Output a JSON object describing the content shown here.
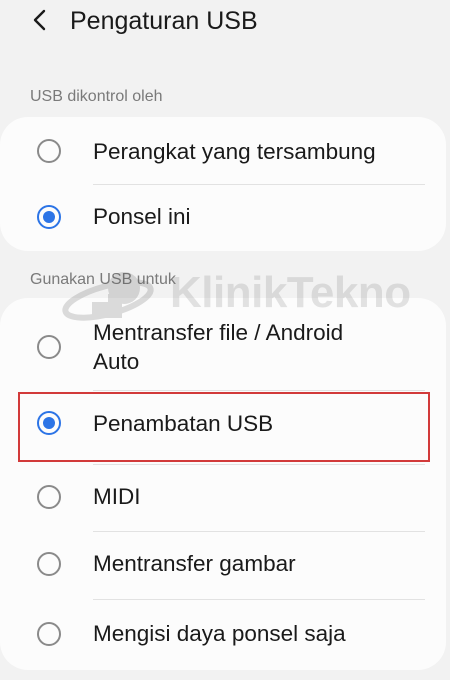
{
  "header": {
    "title": "Pengaturan USB",
    "back_icon": "chevron-left-icon"
  },
  "section_controlled": {
    "label": "USB dikontrol oleh",
    "options": [
      {
        "label": "Perangkat yang tersambung",
        "selected": false
      },
      {
        "label": "Ponsel ini",
        "selected": true
      }
    ]
  },
  "section_usage": {
    "label": "Gunakan USB untuk",
    "options": [
      {
        "label": "Mentransfer file / Android Auto",
        "line1": "Mentransfer file / Android",
        "line2": "Auto",
        "selected": false
      },
      {
        "label": "Penambatan USB",
        "selected": true
      },
      {
        "label": "MIDI",
        "selected": false
      },
      {
        "label": "Mentransfer gambar",
        "selected": false
      },
      {
        "label": "Mengisi daya ponsel saja",
        "selected": false
      }
    ]
  },
  "watermark": {
    "text": "KlinikTekno",
    "icon": "klinik-logo-icon"
  },
  "colors": {
    "accent": "#2c74e6",
    "highlight": "#d23a3a",
    "background": "#f2f2f2",
    "card": "#fcfcfc"
  }
}
